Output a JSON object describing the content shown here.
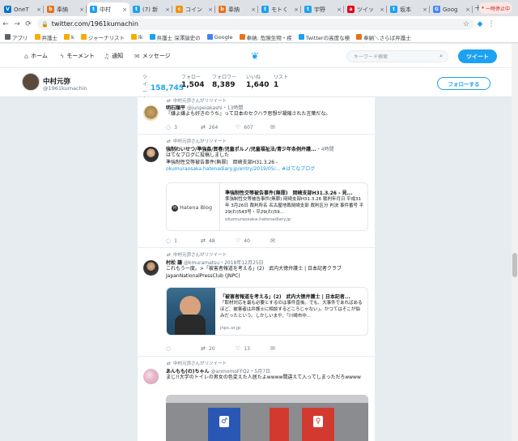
{
  "browser": {
    "tabs": [
      {
        "label": "OneT",
        "color": "#0072c6",
        "glyph": "V"
      },
      {
        "label": "奉納",
        "color": "#e8711a",
        "glyph": "b"
      },
      {
        "label": "中村",
        "color": "#1da1f2",
        "glyph": "t",
        "active": true
      },
      {
        "label": "(7) 新",
        "color": "#1da1f2",
        "glyph": "t"
      },
      {
        "label": "コイン",
        "color": "#f29111",
        "glyph": "c"
      },
      {
        "label": "奉納",
        "color": "#e8711a",
        "glyph": "b"
      },
      {
        "label": "モトく",
        "color": "#1da1f2",
        "glyph": "t"
      },
      {
        "label": "宇野",
        "color": "#1da1f2",
        "glyph": "t"
      },
      {
        "label": "ツイッ",
        "color": "#e2001a",
        "glyph": "a"
      },
      {
        "label": "坂本",
        "color": "#1da1f2",
        "glyph": "t"
      },
      {
        "label": "Goog",
        "color": "#4285f4",
        "glyph": "G"
      }
    ],
    "paused_label": "一時停止中",
    "url": "twitter.com/1961kumachin",
    "bookmarks": [
      {
        "label": "アプリ",
        "color": "#5f6368"
      },
      {
        "label": "弁護士",
        "color": "#f9ab00"
      },
      {
        "label": "k",
        "color": "#f9ab00"
      },
      {
        "label": "ジャーナリスト",
        "color": "#f9ab00"
      },
      {
        "label": "lk",
        "color": "#f9ab00"
      },
      {
        "label": "弁護士 深澤諭史の",
        "color": "#1da1f2"
      },
      {
        "label": "Google",
        "color": "#4285f4"
      },
      {
        "label": "奉納: 危険生物・疾",
        "color": "#e8711a"
      },
      {
        "label": "Twitterの高度な検",
        "color": "#1da1f2"
      },
      {
        "label": "奉納＼さらば弁護士",
        "color": "#e8711a"
      }
    ]
  },
  "twitter_nav": {
    "home": "ホーム",
    "moments": "モーメント",
    "notifications": "通知",
    "messages": "メッセージ",
    "search_placeholder": "キーワード検索",
    "tweet_button": "ツイート"
  },
  "profile": {
    "name": "中村元弥",
    "handle": "@1961kumachin",
    "stats": [
      {
        "label": "ツイート",
        "value": "158,745",
        "active": true
      },
      {
        "label": "フォロー",
        "value": "1,504"
      },
      {
        "label": "フォロワー",
        "value": "8,389"
      },
      {
        "label": "いいね",
        "value": "1,640"
      },
      {
        "label": "リスト",
        "value": "1"
      }
    ],
    "follow_button": "フォローする"
  },
  "tweets": [
    {
      "retweet_note": "中村元弥さんがリツイート",
      "name": "明石順平",
      "handle": "@junpeiakashi",
      "time": "・13時間",
      "text": "『嫌よ嫌よも好きのうち』って日本のセクハラ思想が凝縮された言葉だな。",
      "replies": "3",
      "retweets": "264",
      "likes": "607"
    },
    {
      "retweet_note": "中村元弥さんがリツイート",
      "name": "強制わいせつ/準強姦/買春/児童ポルノ/児童福祉法/青少年条例弁護...",
      "handle": "",
      "time": "・4時間",
      "text_line1": "はてなブログに投稿しました",
      "text_line2": "準強制性交等被告事件(無罪)　岡崎支部H31.3.26 -",
      "text_link": "okumuraosaka.hatenadiary.jp/entry/2019/05/...",
      "text_tag": "#はてなブログ",
      "card_title": "準強制性交等被告事件(無罪)　岡崎支部H31.3.26 - 見...",
      "card_desc": "準強制性交等被告事件(無罪) 岡崎支部H31.3.26 裁判年月日 平成31年 3月26日 裁判所名 名古屋地裁岡崎支部 裁判区分 判決 事件番号 平29(わ)543号・平29(わ)59...",
      "card_url": "okumuraosaka.hatenadiary.jp",
      "card_logo": "Hatena Blog",
      "replies": "1",
      "retweets": "48",
      "likes": "40"
    },
    {
      "retweet_note": "中村元弥さんがリツイート",
      "name": "村松 謙",
      "handle": "@kmuramatsu",
      "time": "・2018年12月25日",
      "text": "これもう一度。>「被害者報道を考える」(2)　武内大徳弁護士 | 日本記者クラブ JapanNationalPressClub (JNPC)",
      "card_title": "「被害者報道を考える」(2)　武内大徳弁護士 | 日本記者...",
      "card_desc": "「取材対応を最も必要とするのは事件直後。でも、大事件であればあるほど、被害者は弁護士に相談するどころじゃない」。かつてはそこが悩みだったという。しかしいまや、「川崎市中...",
      "card_url": "jnpc.or.jp",
      "replies": "",
      "retweets": "20",
      "likes": "13"
    },
    {
      "retweet_note": "中村元弥さんがリツイート",
      "name": "あんもも(の)ちゃん",
      "handle": "@anmomoFFQ2",
      "time": "・5月7日",
      "text": "まじ!!大学のトイレの男女の色変えた人居たよwwww間違えて入ってしまっただろwwww"
    }
  ]
}
